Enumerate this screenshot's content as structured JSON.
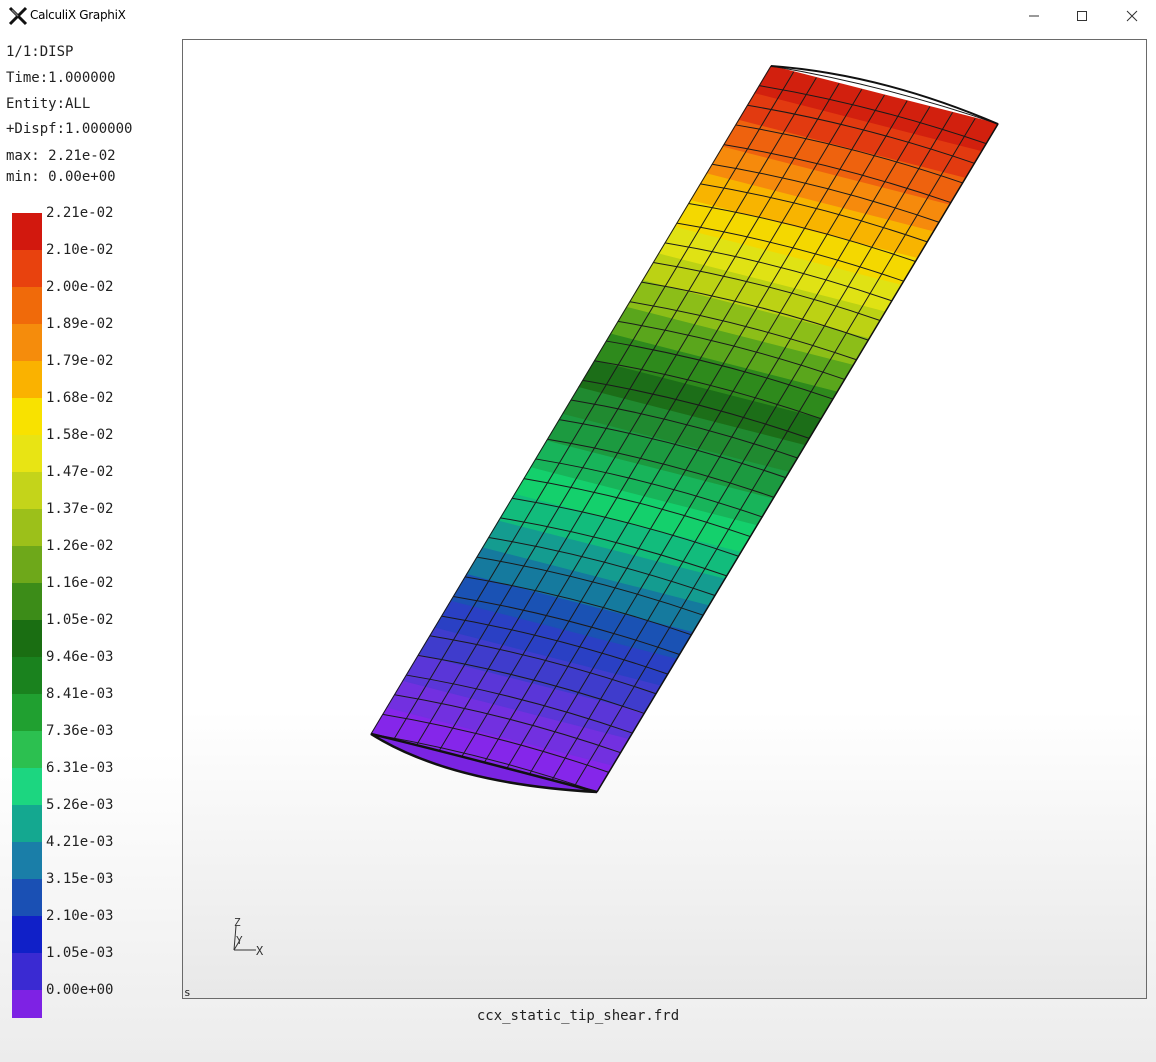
{
  "window": {
    "title": "CalculiX GraphiX",
    "icon": "calculix-x-icon",
    "controls": [
      "minimize-icon",
      "maximize-icon",
      "close-icon"
    ]
  },
  "info": {
    "step": "1/1:DISP",
    "time": "Time:1.000000",
    "entity": "Entity:ALL",
    "dispf": "+Dispf:1.000000",
    "max": "max: 2.21e-02",
    "min": "min: 0.00e+00"
  },
  "legend": {
    "labels": [
      "2.21e-02",
      "2.10e-02",
      "2.00e-02",
      "1.89e-02",
      "1.79e-02",
      "1.68e-02",
      "1.58e-02",
      "1.47e-02",
      "1.37e-02",
      "1.26e-02",
      "1.16e-02",
      "1.05e-02",
      "9.46e-03",
      "8.41e-03",
      "7.36e-03",
      "6.31e-03",
      "5.26e-03",
      "4.21e-03",
      "3.15e-03",
      "2.10e-03",
      "1.05e-03",
      "0.00e+00"
    ],
    "colors": [
      "#d2180e",
      "#e8420e",
      "#f06a0a",
      "#f58c0c",
      "#fab200",
      "#f8e200",
      "#e8e414",
      "#c4d41a",
      "#9cc01a",
      "#6ea81a",
      "#3c8c18",
      "#1a6e12",
      "#1a821e",
      "#20a030",
      "#2cc050",
      "#1cd680",
      "#14a890",
      "#1a7ea8",
      "#1a50b4",
      "#1020c8",
      "#3a2ad2",
      "#7e22e4"
    ]
  },
  "axes_triad": {
    "x": "X",
    "y": "Y",
    "z": "Z"
  },
  "viewport": {
    "corner_label": "s"
  },
  "model": {
    "bands_root_to_tip": [
      "#8526ea",
      "#7230e0",
      "#5a36d8",
      "#3f3ccc",
      "#2a40c4",
      "#1a52b4",
      "#157a9e",
      "#149c90",
      "#12bc7c",
      "#14d06c",
      "#18b45a",
      "#1c9a40",
      "#208a30",
      "#1c6e18",
      "#2e8a1c",
      "#5aa61c",
      "#8cbe18",
      "#bcd214",
      "#e0e214",
      "#f4d800",
      "#f8b400",
      "#f68a0c",
      "#ee620e",
      "#e23a10",
      "#d2200e"
    ]
  },
  "file": {
    "name": "ccx_static_tip_shear.frd"
  }
}
